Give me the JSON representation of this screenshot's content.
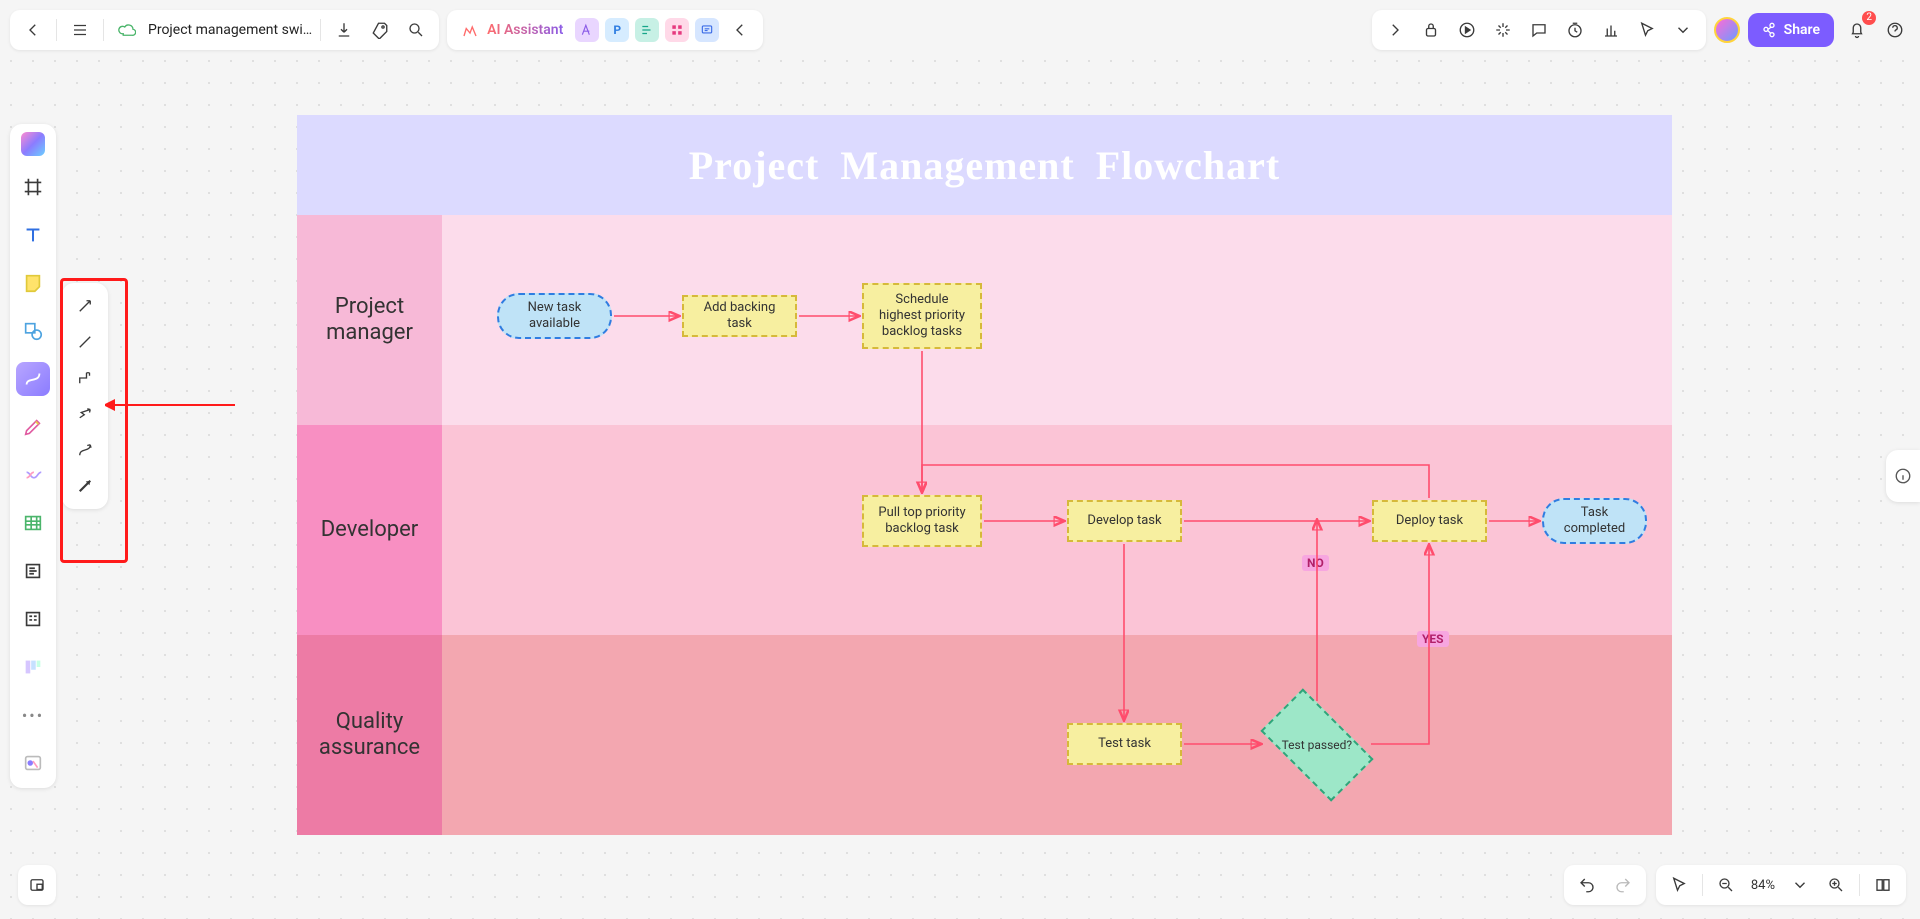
{
  "header": {
    "doc_title": "Project management swi…",
    "ai_label": "AI Assistant",
    "chip_p": "P",
    "notification_count": "2"
  },
  "share": {
    "label": "Share"
  },
  "zoom": {
    "value": "84%"
  },
  "chart_data": {
    "type": "flowchart",
    "title": "Project  Management  Flowchart",
    "lanes": [
      {
        "id": "pm",
        "label": "Project\nmanager"
      },
      {
        "id": "dev",
        "label": "Developer"
      },
      {
        "id": "qa",
        "label": "Quality\nassurance"
      }
    ],
    "nodes": {
      "start": {
        "lane": "pm",
        "type": "terminator",
        "text": "New task available"
      },
      "add": {
        "lane": "pm",
        "type": "process",
        "text": "Add backing task"
      },
      "schedule": {
        "lane": "pm",
        "type": "process",
        "text": "Schedule highest priority backlog tasks"
      },
      "pull": {
        "lane": "dev",
        "type": "process",
        "text": "Pull top priority backlog task"
      },
      "develop": {
        "lane": "dev",
        "type": "process",
        "text": "Develop task"
      },
      "deploy": {
        "lane": "dev",
        "type": "process",
        "text": "Deploy task"
      },
      "end": {
        "lane": "dev",
        "type": "terminator",
        "text": "Task completed"
      },
      "test": {
        "lane": "qa",
        "type": "process",
        "text": "Test task"
      },
      "decision": {
        "lane": "qa",
        "type": "decision",
        "text": "Test passed?"
      }
    },
    "edges": [
      {
        "from": "start",
        "to": "add"
      },
      {
        "from": "add",
        "to": "schedule"
      },
      {
        "from": "schedule",
        "to": "pull"
      },
      {
        "from": "pull",
        "to": "develop"
      },
      {
        "from": "develop",
        "to": "test"
      },
      {
        "from": "test",
        "to": "decision"
      },
      {
        "from": "decision",
        "to": "develop",
        "label": "NO"
      },
      {
        "from": "decision",
        "to": "deploy",
        "label": "YES"
      },
      {
        "from": "deploy",
        "to": "end"
      },
      {
        "from": "deploy",
        "to": "pull",
        "back_edge": true
      }
    ],
    "labels": {
      "no": "NO",
      "yes": "YES"
    }
  }
}
